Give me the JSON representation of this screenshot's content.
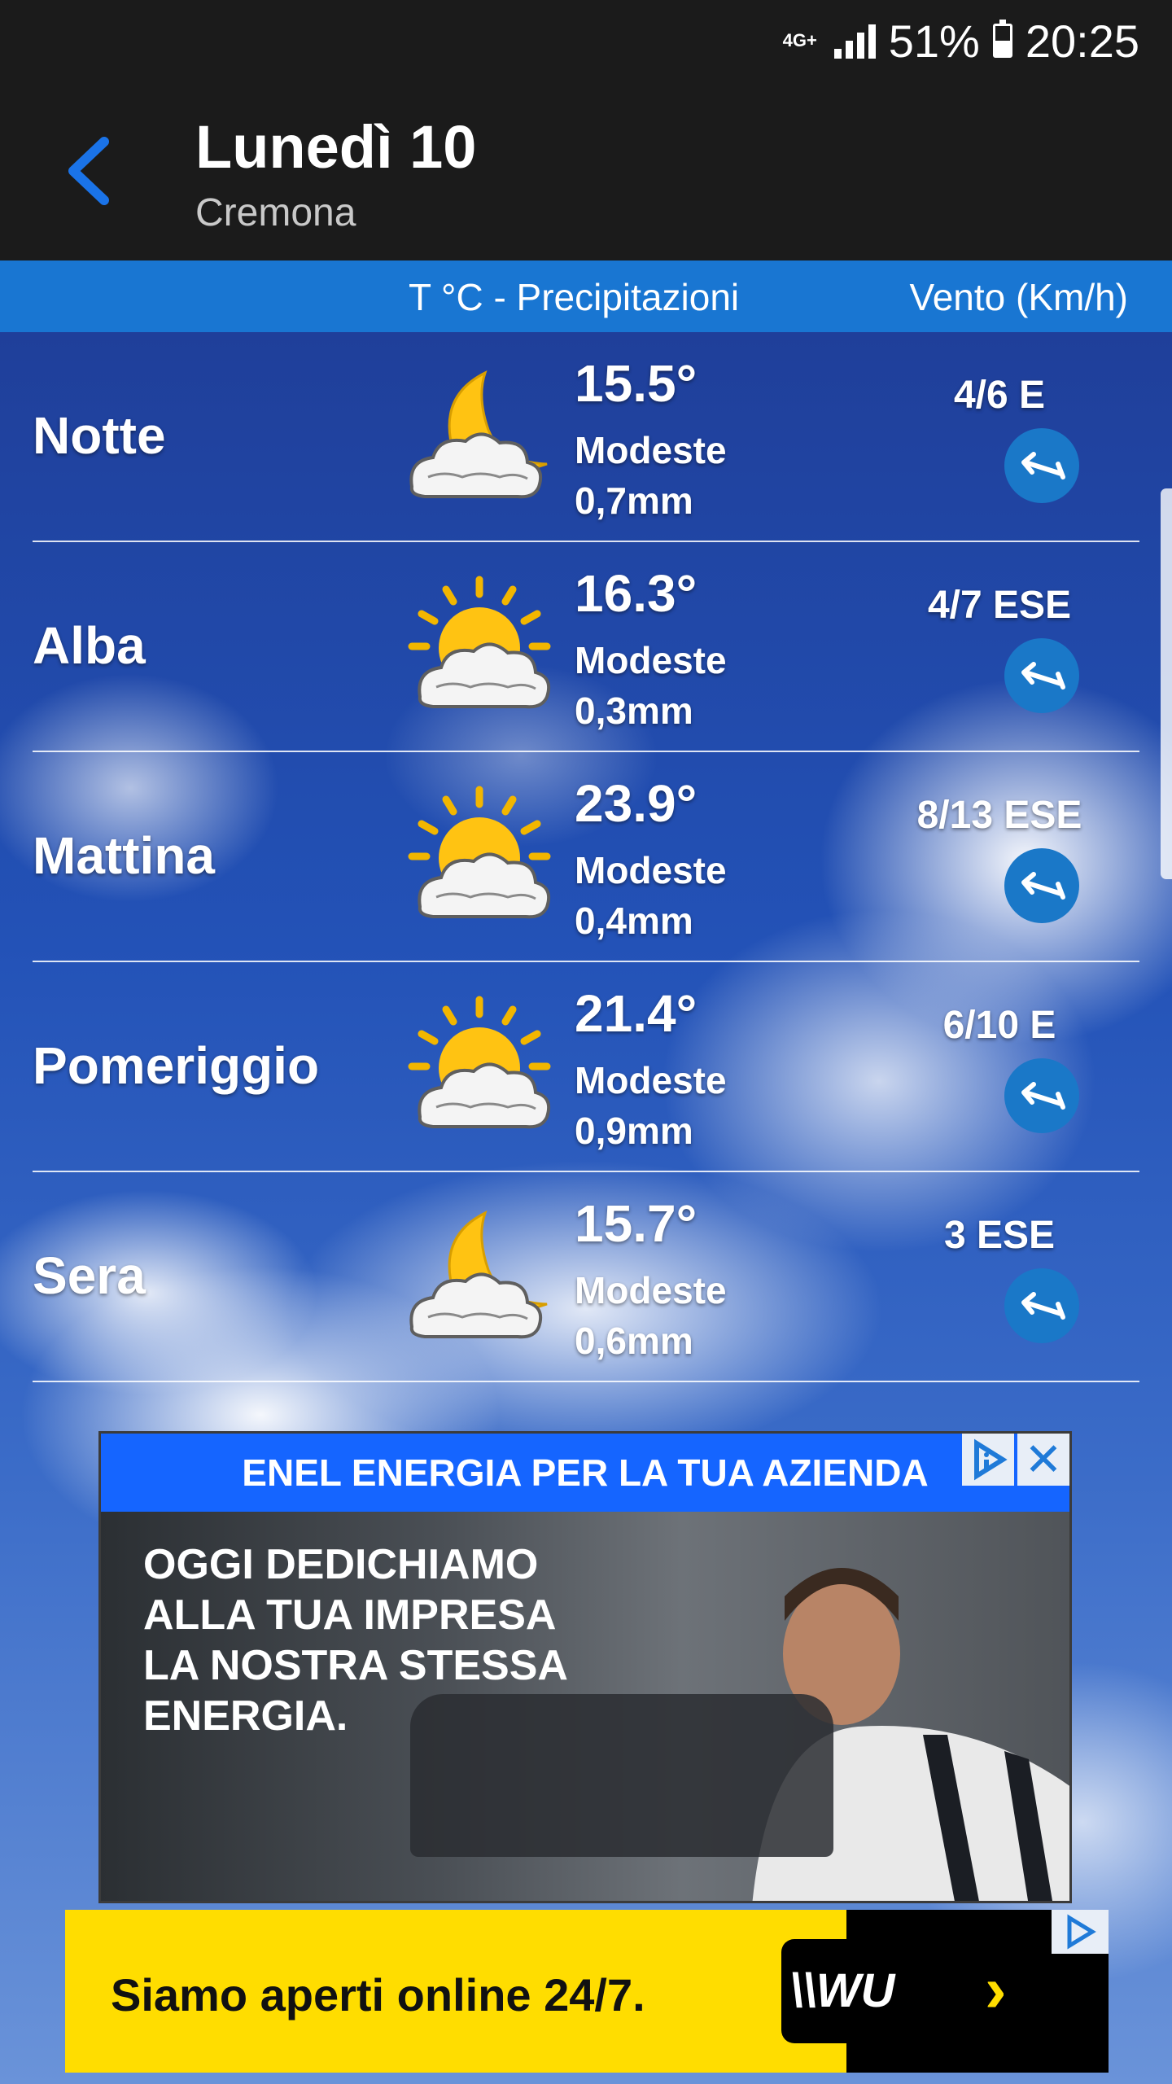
{
  "status_bar": {
    "network": "4G+",
    "battery": "51%",
    "battery_level": 0.51,
    "time": "20:25"
  },
  "header": {
    "title": "Lunedì 10",
    "subtitle": "Cremona"
  },
  "columns": {
    "temp_precip": "T °C  -  Precipitazioni",
    "wind": "Vento (Km/h)"
  },
  "rows": [
    {
      "period": "Notte",
      "icon": "moon-cloud-icon",
      "temp": "15.5°",
      "precip": "Modeste",
      "mm": "0,7mm",
      "wind": "4/6 E"
    },
    {
      "period": "Alba",
      "icon": "sun-cloud-icon",
      "temp": "16.3°",
      "precip": "Modeste",
      "mm": "0,3mm",
      "wind": "4/7 ESE"
    },
    {
      "period": "Mattina",
      "icon": "sun-cloud-icon",
      "temp": "23.9°",
      "precip": "Modeste",
      "mm": "0,4mm",
      "wind": "8/13 ESE"
    },
    {
      "period": "Pomeriggio",
      "icon": "sun-cloud-icon",
      "temp": "21.4°",
      "precip": "Modeste",
      "mm": "0,9mm",
      "wind": "6/10 E"
    },
    {
      "period": "Sera",
      "icon": "moon-cloud-icon",
      "temp": "15.7°",
      "precip": "Modeste",
      "mm": "0,6mm",
      "wind": "3 ESE"
    }
  ],
  "ad1": {
    "headline": "ENEL ENERGIA PER LA TUA AZIENDA",
    "copy_lines": [
      "OGGI DEDICHIAMO",
      "ALLA TUA IMPRESA",
      "LA NOSTRA STESSA",
      "ENERGIA."
    ],
    "close": "✕"
  },
  "ad2": {
    "text": "Siamo aperti online 24/7.",
    "brand": "\\\\WU",
    "arrow": "›"
  },
  "colors": {
    "appbar": "#1b1b1b",
    "accent_blue": "#1976d2",
    "back_arrow": "#1a73e8",
    "wind_circle": "#1a78c8",
    "ad2_yellow": "#ffdd00"
  }
}
